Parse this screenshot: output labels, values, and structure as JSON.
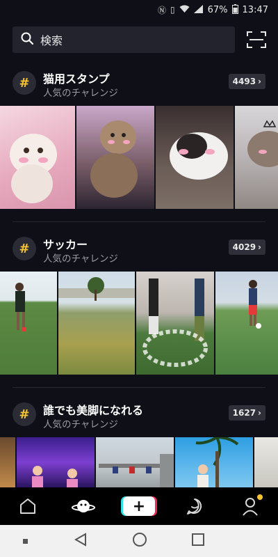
{
  "status_bar": {
    "battery": "67%",
    "time": "13:47"
  },
  "search": {
    "placeholder": "検索"
  },
  "sections": [
    {
      "title": "猫用スタンプ",
      "subtitle": "人気のチャレンジ",
      "count": "4493"
    },
    {
      "title": "サッカー",
      "subtitle": "人気のチャレンジ",
      "count": "4029"
    },
    {
      "title": "誰でも美脚になれる",
      "subtitle": "人気のチャレンジ",
      "count": "1627"
    }
  ],
  "hash_symbol": "#",
  "colors": {
    "accent": "#f6c431",
    "background": "#0f1017",
    "cyan": "#30e3e9",
    "red": "#ee2c5c"
  },
  "icons": {
    "search": "search-icon",
    "scan": "scan-icon",
    "home": "home-icon",
    "discover": "planet-icon",
    "create": "plus-icon",
    "messages": "chat-icon",
    "profile": "profile-icon"
  }
}
